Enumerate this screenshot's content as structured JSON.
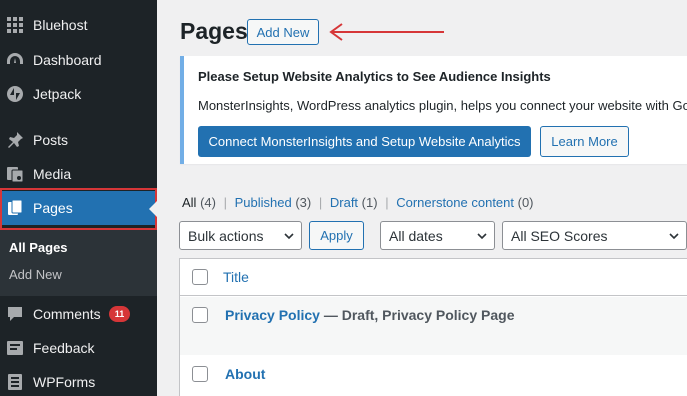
{
  "sidebar": {
    "items": [
      {
        "label": "Bluehost",
        "icon": "grid-icon"
      },
      {
        "label": "Dashboard",
        "icon": "dashboard-icon"
      },
      {
        "label": "Jetpack",
        "icon": "jetpack-icon"
      },
      {
        "label": "Posts",
        "icon": "pushpin-icon"
      },
      {
        "label": "Media",
        "icon": "media-icon"
      },
      {
        "label": "Pages",
        "icon": "pages-icon",
        "active": true
      },
      {
        "label": "Comments",
        "icon": "comment-icon",
        "badge": "11"
      },
      {
        "label": "Feedback",
        "icon": "feedback-icon"
      },
      {
        "label": "WPForms",
        "icon": "forms-icon"
      }
    ],
    "submenu": [
      "All Pages",
      "Add New"
    ]
  },
  "header": {
    "title": "Pages",
    "add_new": "Add New"
  },
  "notice": {
    "title": "Please Setup Website Analytics to See Audience Insights",
    "desc": "MonsterInsights, WordPress analytics plugin, helps you connect your website with Goo",
    "connect_btn": "Connect MonsterInsights and Setup Website Analytics",
    "learn_btn": "Learn More"
  },
  "filters": {
    "all": "All",
    "all_count": "(4)",
    "published": "Published",
    "published_count": "(3)",
    "draft": "Draft",
    "draft_count": "(1)",
    "cornerstone": "Cornerstone content",
    "cornerstone_count": "(0)",
    "sep": "|"
  },
  "actions": {
    "bulk": "Bulk actions",
    "apply": "Apply",
    "dates": "All dates",
    "seo": "All SEO Scores"
  },
  "table": {
    "header": "Title",
    "rows": [
      {
        "title": "Privacy Policy",
        "state": " — Draft, Privacy Policy Page"
      },
      {
        "title": "About"
      }
    ]
  },
  "colors": {
    "accent": "#2271b1",
    "sidebar_bg": "#1d2327",
    "highlight": "#d63638",
    "badge": "#d63638"
  }
}
